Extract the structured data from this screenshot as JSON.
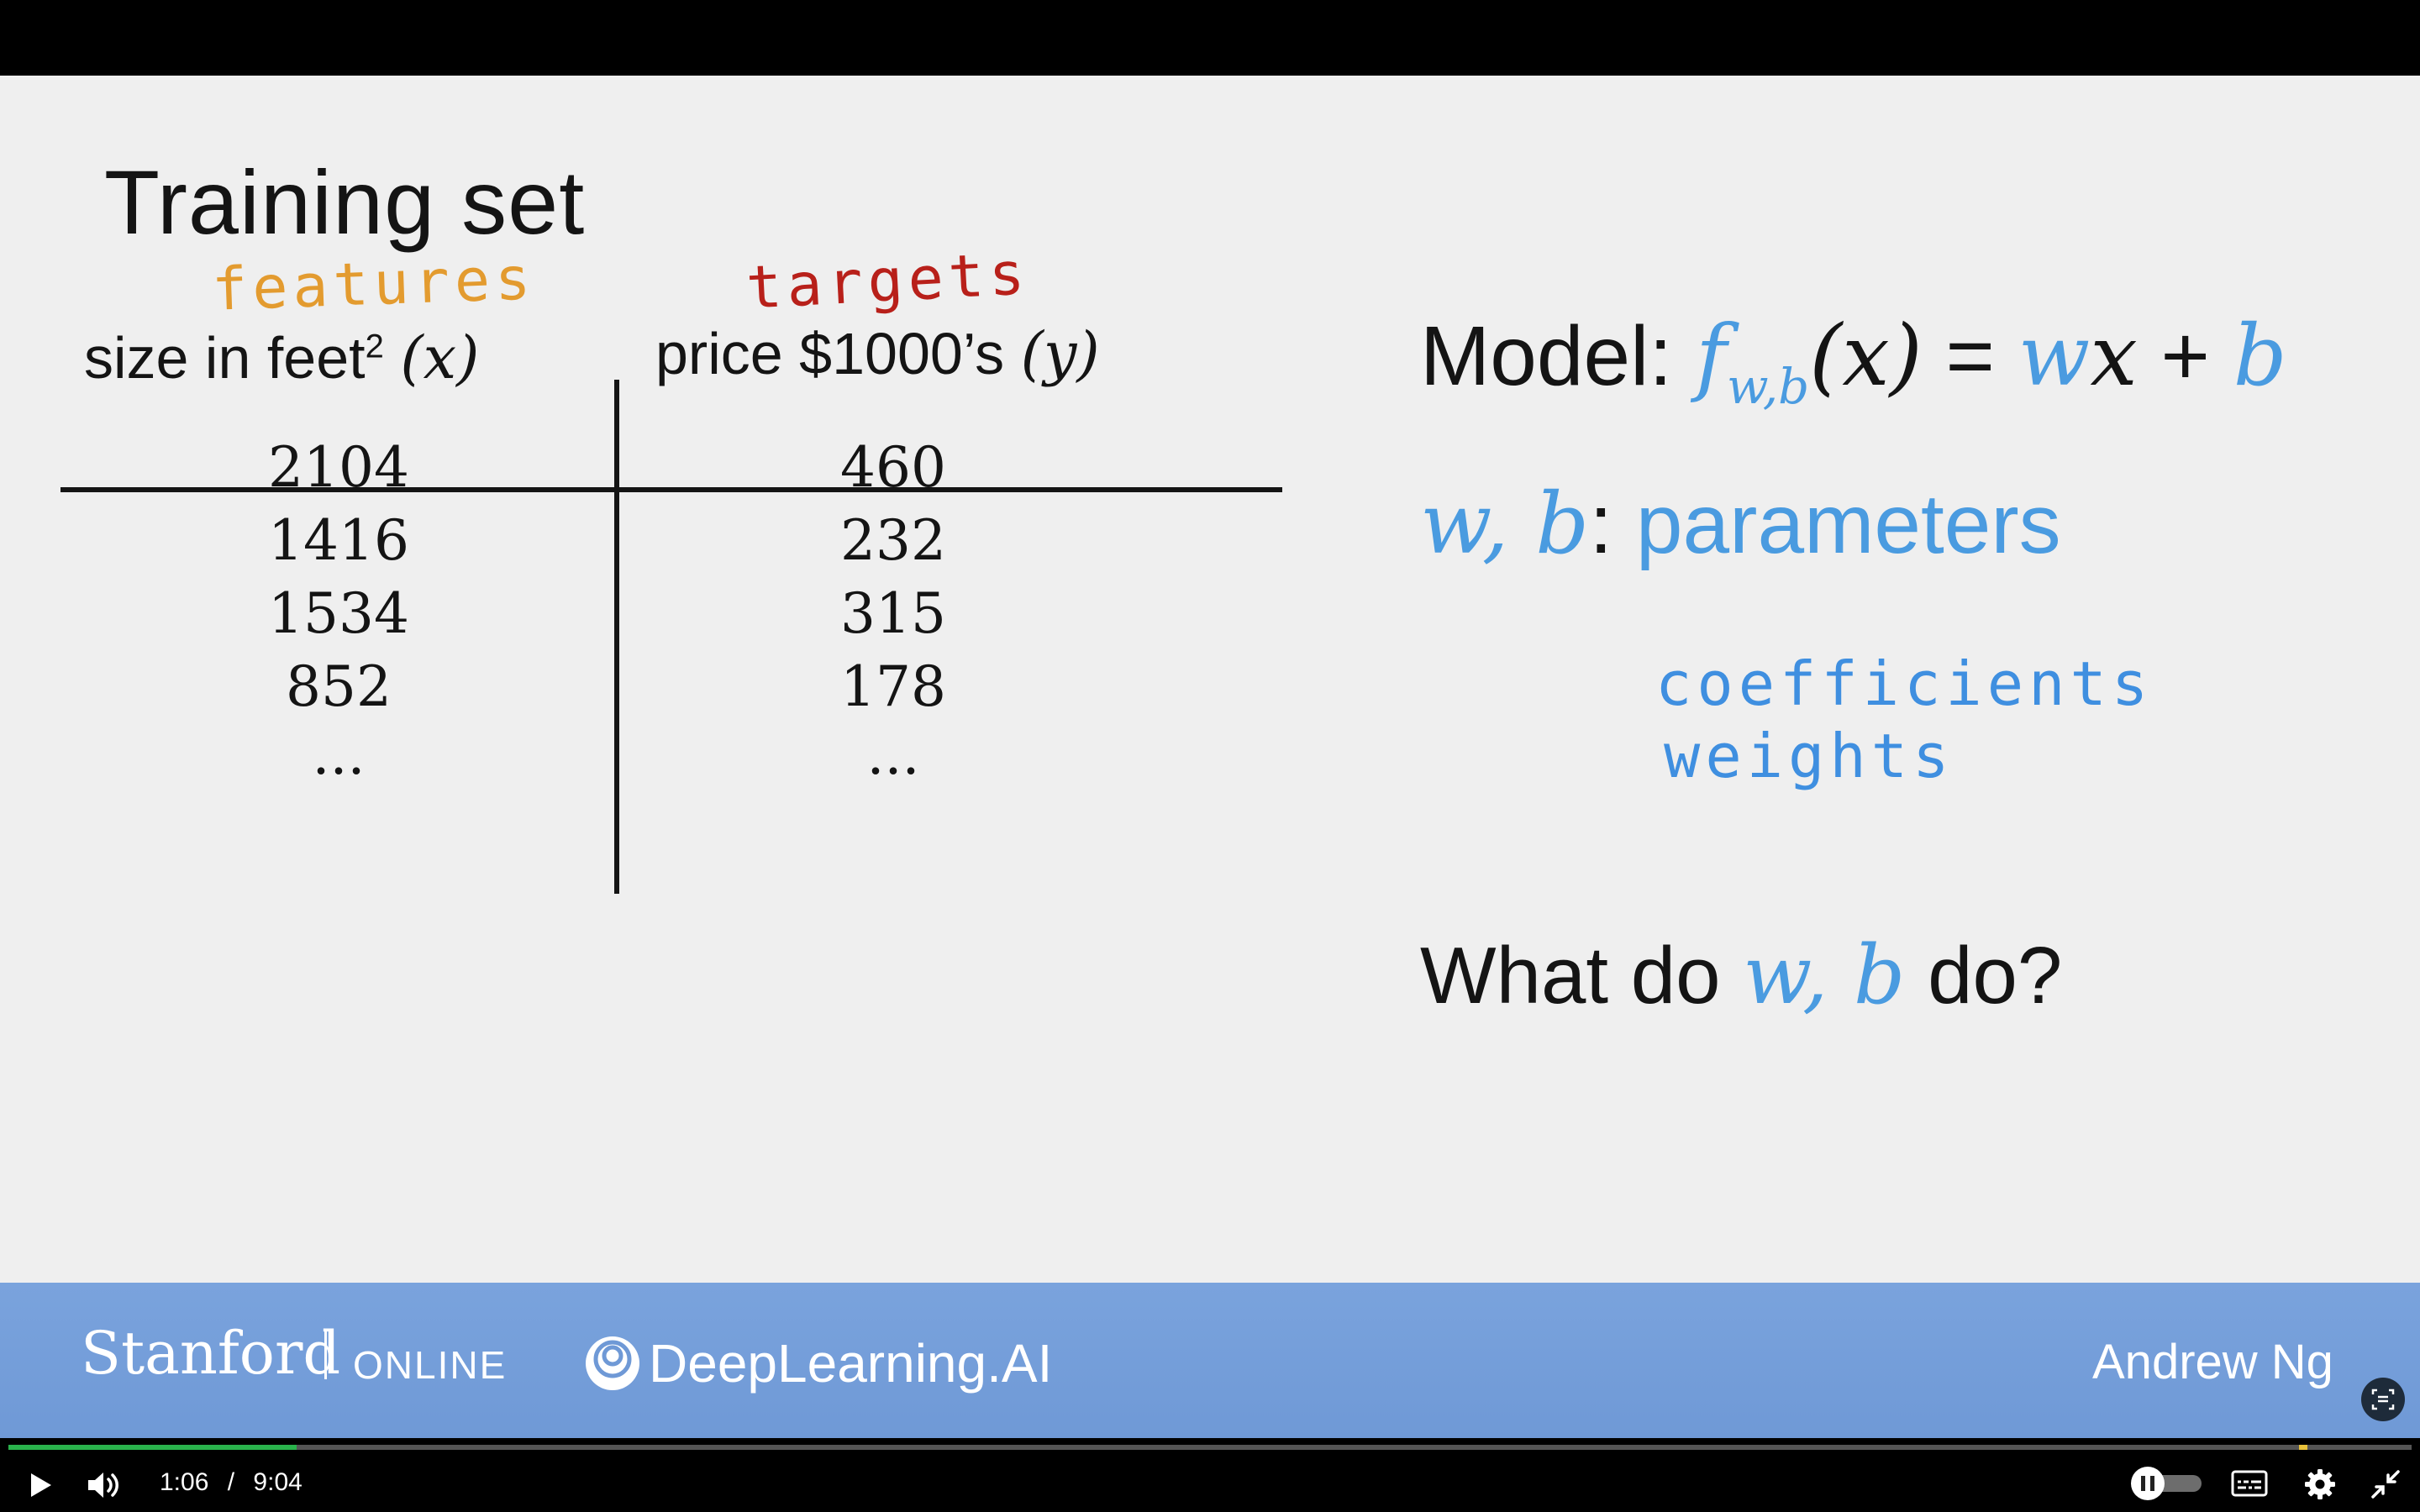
{
  "slide": {
    "title": "Training set",
    "features_note": "features",
    "targets_note": "targets",
    "col_x": {
      "label": "size in feet",
      "sup": "2",
      "var": "(x)"
    },
    "col_y": {
      "label": "price $1000’s",
      "var": "(y)"
    },
    "rows_x": [
      "2104",
      "1416",
      "1534",
      "852",
      "..."
    ],
    "rows_y": [
      "460",
      "232",
      "315",
      "178",
      "..."
    ],
    "model": {
      "label": "Model:",
      "f": "f",
      "f_sub": "w,b",
      "args": "(x)",
      "eq": " = ",
      "w": "w",
      "x": "x",
      "plus": " + ",
      "b": "b"
    },
    "params": {
      "vars": "w, b",
      "colon": ":",
      "word": "parameters"
    },
    "coefficients_note": "coefficients",
    "weights_note": "weights",
    "question": {
      "prefix": "What do ",
      "vars": "w, b",
      "suffix": " do?"
    }
  },
  "footer": {
    "stanford": "Stanford",
    "online": "ONLINE",
    "deeplearning": "DeepLearning.AI",
    "presenter": "Andrew Ng"
  },
  "player": {
    "current_time": "1:06",
    "separator": "/",
    "duration": "9:04",
    "progress_fraction": 0.12,
    "icons": [
      "play-icon",
      "volume-icon",
      "pause-toggle-icon",
      "captions-icon",
      "gear-icon",
      "exit-fullscreen-icon",
      "transcript-icon"
    ]
  },
  "colors": {
    "slide_bg": "#efefef",
    "accent_blue": "#4a9be0",
    "features_orange": "#e39b2f",
    "targets_red": "#b8201a",
    "footer_blue": "#7aa3dd",
    "progress_green": "#2ab34c"
  }
}
